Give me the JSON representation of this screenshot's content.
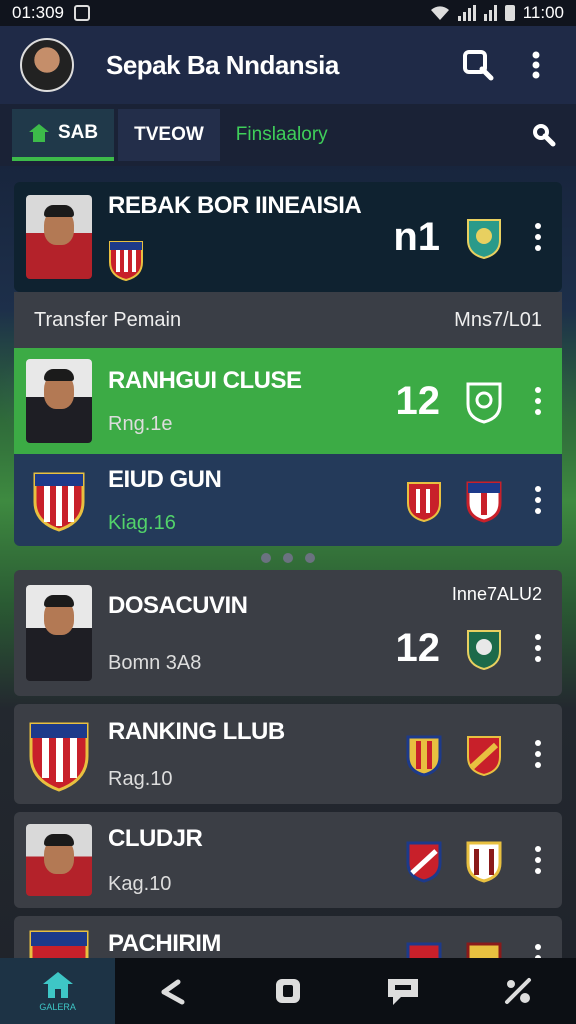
{
  "status": {
    "time_left": "01:309",
    "time_right": "11:00"
  },
  "app": {
    "title": "Sepak Ba Nndansia"
  },
  "tabs": [
    {
      "label": "SAB"
    },
    {
      "label": "TVEOW"
    },
    {
      "label": "Finslaalory"
    }
  ],
  "cards": [
    {
      "title": "REBAK BOR IINEAISIA",
      "score": "n1"
    },
    {
      "title": "RANHGUI CLUSE",
      "sub": "Rng.1e",
      "score": "12"
    },
    {
      "title": "EIUD GUN",
      "sub": "Kiag.16"
    },
    {
      "title": "DOSACUVIN",
      "sub": "Bomn 3A8",
      "score": "12",
      "meta": "Inne7ALU2"
    },
    {
      "title": "RANKING LLUB",
      "sub": "Rag.10"
    },
    {
      "title": "CLUDJR",
      "sub": "Kag.10"
    },
    {
      "title": "PACHIRIM"
    }
  ],
  "transfer": {
    "label": "Transfer Pemain",
    "meta": "Mns7/L01"
  },
  "bottom_nav": {
    "home_label": "GALERA"
  },
  "colors": {
    "accent_green": "#3dbb4a",
    "card_green": "#3cab45",
    "card_navy": "#243a5a",
    "card_dark": "#0f2230"
  }
}
